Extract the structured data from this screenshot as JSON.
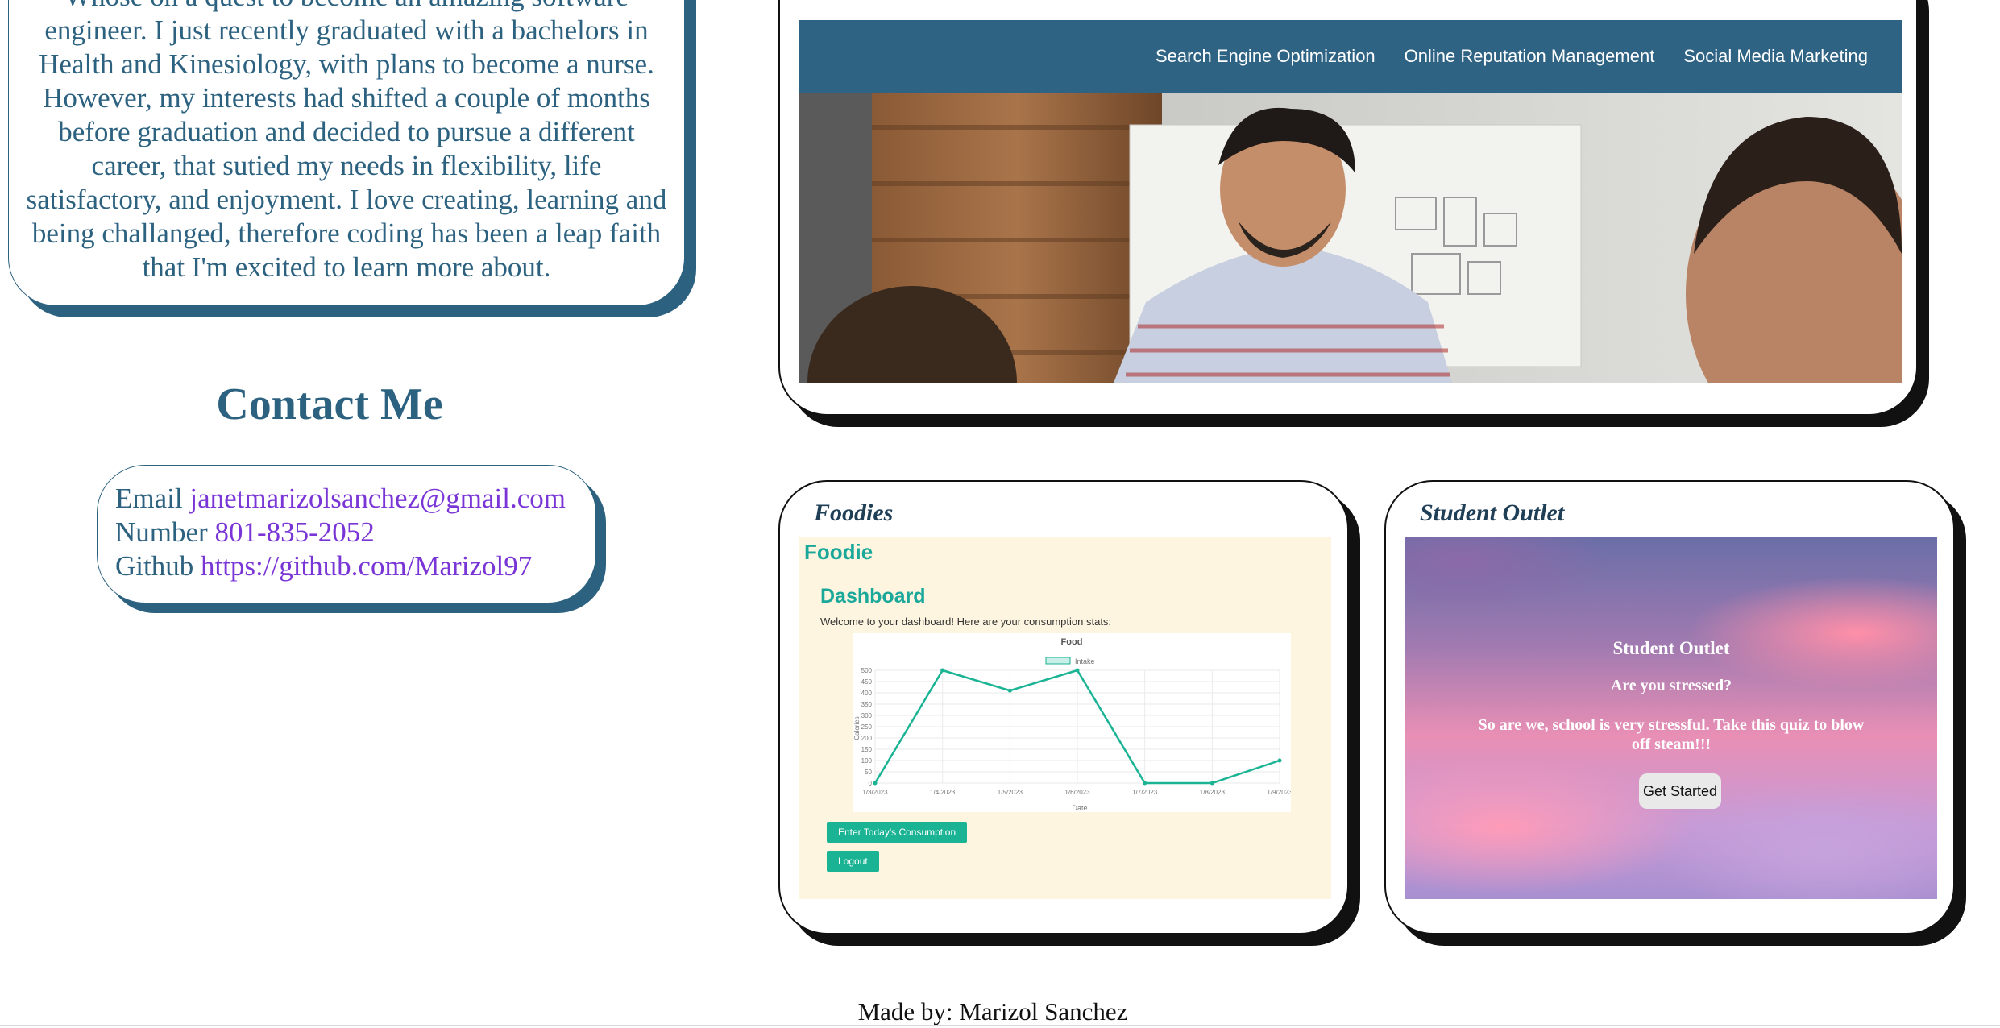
{
  "about": {
    "text": "Whose on a quest to become an amazing software engineer. I just recently graduated with a bachelors in Health and Kinesiology, with plans to become a nurse. However, my interests had shifted a couple of months before graduation and decided to pursue a different career, that sutied my needs in flexibility, life satisfactory, and enjoyment. I love creating, learning and being challanged, therefore coding has been a leap faith that I'm excited to learn more about."
  },
  "contact": {
    "heading": "Contact Me",
    "email_label": "Email",
    "email_value": "janetmarizolsanchez@gmail.com",
    "number_label": "Number",
    "number_value": "801-835-2052",
    "github_label": "Github",
    "github_value": "https://github.com/Marizol97"
  },
  "hero_project": {
    "nav_items": [
      "Search Engine Optimization",
      "Online Reputation Management",
      "Social Media Marketing"
    ],
    "colors": {
      "nav_bg": "#2f6384"
    }
  },
  "foodie_project": {
    "title": "Foodies",
    "screenshot": {
      "brand": "Foodie",
      "heading": "Dashboard",
      "welcome": "Welcome to your dashboard! Here are your consumption stats:",
      "buttons": [
        "Enter Today's Consumption",
        "Logout"
      ],
      "chart_data": {
        "type": "line",
        "title": "Food",
        "legend": [
          "Intake"
        ],
        "xlabel": "Date",
        "ylabel": "Calories",
        "categories": [
          "1/3/2023",
          "1/4/2023",
          "1/5/2023",
          "1/6/2023",
          "1/7/2023",
          "1/8/2023",
          "1/9/2023"
        ],
        "series": [
          {
            "name": "Intake",
            "values": [
              0,
              500,
              410,
              500,
              0,
              0,
              100
            ]
          }
        ],
        "yticks": [
          0,
          50,
          100,
          150,
          200,
          250,
          300,
          350,
          400,
          450,
          500
        ],
        "ylim": [
          0,
          500
        ],
        "grid": true,
        "legend_position": "top",
        "color": "#1ab394"
      }
    }
  },
  "student_project": {
    "title": "Student Outlet",
    "screenshot": {
      "heading": "Student Outlet",
      "question": "Are you stressed?",
      "message": "So are we, school is very stressful. Take this quiz to blow off steam!!!",
      "button": "Get Started"
    }
  },
  "footer": {
    "text": "Made by: Marizol Sanchez"
  }
}
